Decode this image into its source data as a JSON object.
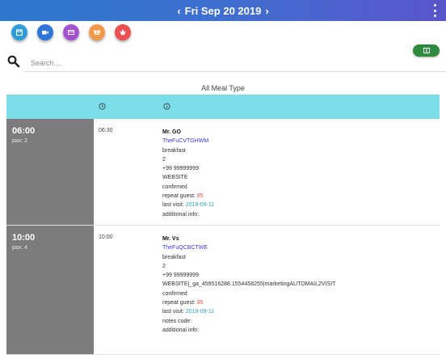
{
  "header": {
    "date": "Fri Sep 20 2019",
    "prev_icon": "chevron-left-icon",
    "next_icon": "chevron-right-icon",
    "menu_icon": "kebab-menu-icon"
  },
  "quick_actions": [
    {
      "icon": "calendar-icon",
      "color": "#2f9bd8"
    },
    {
      "icon": "video-icon",
      "color": "#2f74d9"
    },
    {
      "icon": "card-icon",
      "color": "#a451d1"
    },
    {
      "icon": "group-icon",
      "color": "#f39a4a"
    },
    {
      "icon": "bug-icon",
      "color": "#ea4f52"
    }
  ],
  "green_button": {
    "icon": "list-icon",
    "color": "#2e8b3e"
  },
  "search": {
    "placeholder": "Search....",
    "value": ""
  },
  "meal_filter": "All Meal Type",
  "table_header": {
    "time_icon": "clock-icon",
    "info_icon": "info-icon",
    "color": "#7bdde8"
  },
  "reservations": [
    {
      "slot_time": "06:00",
      "pax": "pax: 2",
      "time": "06:30",
      "name": "Mr. GO",
      "code": "TheFuCVTGHWM",
      "meal": "breakfast",
      "guests": "2",
      "phone": "+99 99999999",
      "source": "WEBSITE",
      "status": "confirmed",
      "repeat_label": "repeat guest: ",
      "repeat_count": "85",
      "last_visit_label": "last visit: ",
      "last_visit": "2019-09-11",
      "extra": "additional info:"
    },
    {
      "slot_time": "10:00",
      "pax": "pax: 4",
      "time": "10:00",
      "name": "Mr. Vs",
      "code": "TheFuQCBCTWE",
      "meal": "breakfast",
      "guests": "2",
      "phone": "+99 99999999",
      "source": "WEBSITE|_ga_459516288.1554458255|marketingAUTOMAIL2VISIT",
      "status": "confirmed",
      "repeat_label": "repeat guest: ",
      "repeat_count": "85",
      "last_visit_label": "last visit: ",
      "last_visit": "2019-09-11",
      "notes": "notes code:",
      "extra": "additional info:"
    }
  ]
}
